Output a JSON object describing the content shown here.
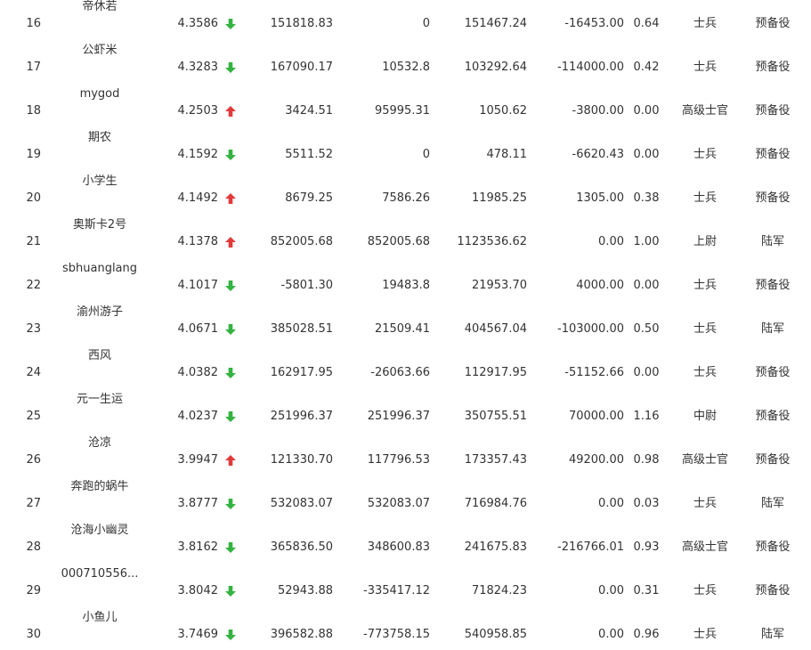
{
  "colors": {
    "up_arrow": "#e23a3a",
    "down_arrow": "#33b33f",
    "text": "#333333"
  },
  "rows": [
    {
      "rank": "16",
      "name": "帝休若",
      "score": "4.3586",
      "trend": "down",
      "v1": "151818.83",
      "v2": "0",
      "v3": "151467.24",
      "v4": "-16453.00",
      "rate": "0.64",
      "rank_title": "士兵",
      "status": "预备役"
    },
    {
      "rank": "17",
      "name": "公虾米",
      "score": "4.3283",
      "trend": "down",
      "v1": "167090.17",
      "v2": "10532.8",
      "v3": "103292.64",
      "v4": "-114000.00",
      "rate": "0.42",
      "rank_title": "士兵",
      "status": "预备役"
    },
    {
      "rank": "18",
      "name": "mygod",
      "score": "4.2503",
      "trend": "up",
      "v1": "3424.51",
      "v2": "95995.31",
      "v3": "1050.62",
      "v4": "-3800.00",
      "rate": "0.00",
      "rank_title": "高级士官",
      "status": "预备役"
    },
    {
      "rank": "19",
      "name": "期农",
      "score": "4.1592",
      "trend": "down",
      "v1": "5511.52",
      "v2": "0",
      "v3": "478.11",
      "v4": "-6620.43",
      "rate": "0.00",
      "rank_title": "士兵",
      "status": "预备役"
    },
    {
      "rank": "20",
      "name": "小学生",
      "score": "4.1492",
      "trend": "up",
      "v1": "8679.25",
      "v2": "7586.26",
      "v3": "11985.25",
      "v4": "1305.00",
      "rate": "0.38",
      "rank_title": "士兵",
      "status": "预备役"
    },
    {
      "rank": "21",
      "name": "奥斯卡2号",
      "score": "4.1378",
      "trend": "up",
      "v1": "852005.68",
      "v2": "852005.68",
      "v3": "1123536.62",
      "v4": "0.00",
      "rate": "1.00",
      "rank_title": "上尉",
      "status": "陆军"
    },
    {
      "rank": "22",
      "name": "sbhuanglang",
      "score": "4.1017",
      "trend": "down",
      "v1": "-5801.30",
      "v2": "19483.8",
      "v3": "21953.70",
      "v4": "4000.00",
      "rate": "0.00",
      "rank_title": "士兵",
      "status": "预备役"
    },
    {
      "rank": "23",
      "name": "渝州游子",
      "score": "4.0671",
      "trend": "down",
      "v1": "385028.51",
      "v2": "21509.41",
      "v3": "404567.04",
      "v4": "-103000.00",
      "rate": "0.50",
      "rank_title": "士兵",
      "status": "陆军"
    },
    {
      "rank": "24",
      "name": "西风",
      "score": "4.0382",
      "trend": "down",
      "v1": "162917.95",
      "v2": "-26063.66",
      "v3": "112917.95",
      "v4": "-51152.66",
      "rate": "0.00",
      "rank_title": "士兵",
      "status": "预备役"
    },
    {
      "rank": "25",
      "name": "元一生运",
      "score": "4.0237",
      "trend": "down",
      "v1": "251996.37",
      "v2": "251996.37",
      "v3": "350755.51",
      "v4": "70000.00",
      "rate": "1.16",
      "rank_title": "中尉",
      "status": "预备役"
    },
    {
      "rank": "26",
      "name": "沧凉",
      "score": "3.9947",
      "trend": "up",
      "v1": "121330.70",
      "v2": "117796.53",
      "v3": "173357.43",
      "v4": "49200.00",
      "rate": "0.98",
      "rank_title": "高级士官",
      "status": "预备役"
    },
    {
      "rank": "27",
      "name": "奔跑的蜗牛",
      "score": "3.8777",
      "trend": "down",
      "v1": "532083.07",
      "v2": "532083.07",
      "v3": "716984.76",
      "v4": "0.00",
      "rate": "0.03",
      "rank_title": "士兵",
      "status": "陆军"
    },
    {
      "rank": "28",
      "name": "沧海小幽灵",
      "score": "3.8162",
      "trend": "down",
      "v1": "365836.50",
      "v2": "348600.83",
      "v3": "241675.83",
      "v4": "-216766.01",
      "rate": "0.93",
      "rank_title": "高级士官",
      "status": "预备役"
    },
    {
      "rank": "29",
      "name": "000710556...",
      "score": "3.8042",
      "trend": "down",
      "v1": "52943.88",
      "v2": "-335417.12",
      "v3": "71824.23",
      "v4": "0.00",
      "rate": "0.31",
      "rank_title": "士兵",
      "status": "预备役"
    },
    {
      "rank": "30",
      "name": "小鱼儿",
      "score": "3.7469",
      "trend": "down",
      "v1": "396582.88",
      "v2": "-773758.15",
      "v3": "540958.85",
      "v4": "0.00",
      "rate": "0.96",
      "rank_title": "士兵",
      "status": "陆军"
    }
  ]
}
